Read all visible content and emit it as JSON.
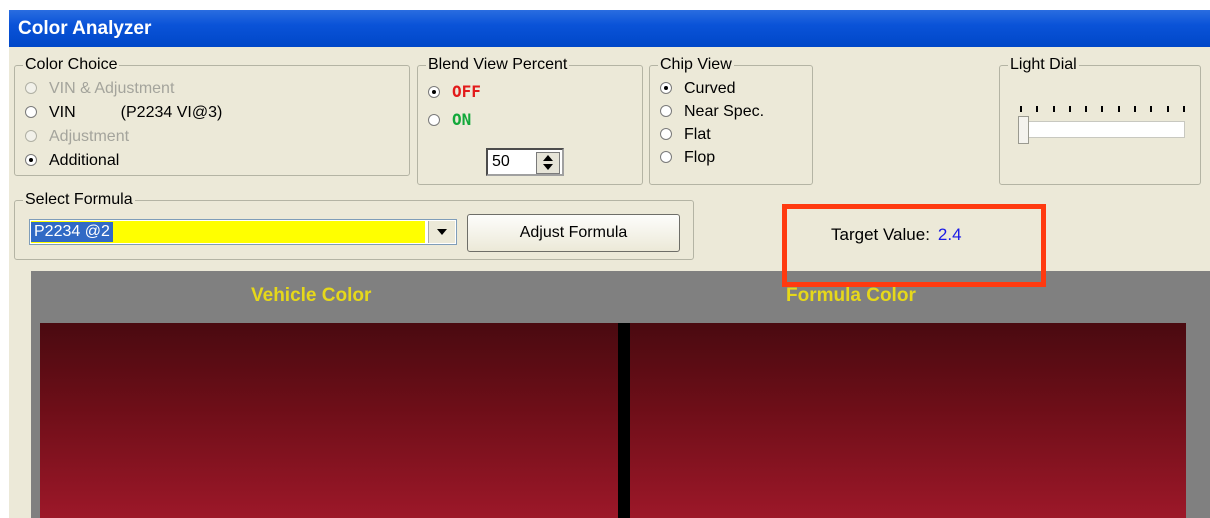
{
  "window": {
    "title": "Color Analyzer"
  },
  "color_choice": {
    "title": "Color Choice",
    "options": [
      {
        "label": "VIN & Adjustment",
        "state": "disabled",
        "extra": ""
      },
      {
        "label": "VIN",
        "state": "enabled",
        "extra": "(P2234 VI@3)"
      },
      {
        "label": "Adjustment",
        "state": "disabled",
        "extra": ""
      },
      {
        "label": "Additional",
        "state": "checked",
        "extra": ""
      }
    ]
  },
  "blend_view": {
    "title": "Blend View Percent",
    "off_label": "OFF",
    "on_label": "ON",
    "selected": "OFF",
    "percent": "50"
  },
  "chip_view": {
    "title": "Chip View",
    "options": [
      "Curved",
      "Near Spec.",
      "Flat",
      "Flop"
    ],
    "selected": "Curved"
  },
  "light_dial": {
    "title": "Light Dial",
    "value": 0
  },
  "formula": {
    "title": "Select Formula",
    "selected": "P2234 @2",
    "adjust_button": "Adjust Formula"
  },
  "target": {
    "label": "Target Value:",
    "value": "2.4"
  },
  "preview": {
    "vehicle_label": "Vehicle Color",
    "formula_label": "Formula Color",
    "colors": {
      "top": "#4a0a10",
      "bottom": "#a3192b"
    }
  },
  "colors": {
    "accent": "#0047c8",
    "highlight": "#ff3a10",
    "formula_bg": "#ffff00"
  }
}
